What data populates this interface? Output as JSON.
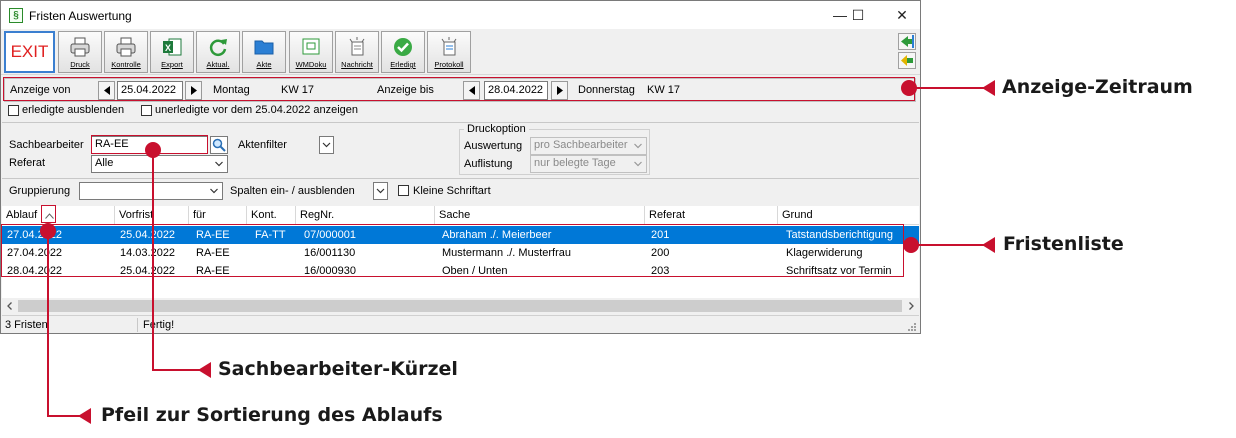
{
  "window": {
    "title": "Fristen Auswertung",
    "controls": {
      "minimize": "—",
      "maximize": "☐",
      "close": "✕"
    }
  },
  "toolbar": {
    "exit": "EXIT",
    "buttons": [
      {
        "label": "Druck",
        "icon": "printer-icon"
      },
      {
        "label": "Kontrolle",
        "icon": "printer-icon"
      },
      {
        "label": "Export",
        "icon": "excel-icon"
      },
      {
        "label": "Aktual.",
        "icon": "refresh-icon"
      },
      {
        "label": "Akte",
        "icon": "folder-icon"
      },
      {
        "label": "WMDoku",
        "icon": "document-icon"
      },
      {
        "label": "Nachricht",
        "icon": "message-icon"
      },
      {
        "label": "Erledigt",
        "icon": "check-icon"
      },
      {
        "label": "Protokoll",
        "icon": "protocol-icon"
      }
    ]
  },
  "zeitraum": {
    "von_label": "Anzeige von",
    "von_date": "25.04.2022",
    "von_weekday": "Montag",
    "von_kw": "KW 17",
    "bis_label": "Anzeige bis",
    "bis_date": "28.04.2022",
    "bis_weekday": "Donnerstag",
    "bis_kw": "KW 17"
  },
  "options": {
    "hide_done": "erledigte ausblenden",
    "show_open_before": "unerledigte vor dem 25.04.2022 anzeigen"
  },
  "filter": {
    "sachbearbeiter_label": "Sachbearbeiter",
    "sachbearbeiter_value": "RA-EE",
    "aktenfilter_label": "Aktenfilter",
    "referat_label": "Referat",
    "referat_value": "Alle"
  },
  "druckoption": {
    "title": "Druckoption",
    "auswertung_label": "Auswertung",
    "auswertung_value": "pro Sachbearbeiter",
    "auflistung_label": "Auflistung",
    "auflistung_value": "nur belegte Tage"
  },
  "gruppierung": {
    "label": "Gruppierung",
    "value": "",
    "spalten_label": "Spalten ein- / ausblenden",
    "kleine_schrift": "Kleine Schriftart"
  },
  "table": {
    "columns": [
      "Ablauf",
      "Vorfrist",
      "für",
      "Kont.",
      "RegNr.",
      "Sache",
      "Referat",
      "Grund"
    ],
    "rows": [
      [
        "27.04.2022",
        "25.04.2022",
        "RA-EE",
        "FA-TT",
        "07/000001",
        "Abraham ./. Meierbeer",
        "201",
        "Tatstandsberichtigung"
      ],
      [
        "27.04.2022",
        "14.03.2022",
        "RA-EE",
        "",
        "16/001130",
        "Mustermann ./. Musterfrau",
        "200",
        "Klagerwiderung"
      ],
      [
        "28.04.2022",
        "25.04.2022",
        "RA-EE",
        "",
        "16/000930",
        "Oben / Unten",
        "203",
        "Schriftsatz vor Termin"
      ]
    ]
  },
  "status": {
    "count": "3 Fristen",
    "state": "Fertig!"
  },
  "annotations": {
    "zeitraum": "Anzeige-Zeitraum",
    "fristenliste": "Fristenliste",
    "kuerzel": "Sachbearbeiter-Kürzel",
    "sortierung": "Pfeil zur Sortierung des Ablaufs"
  },
  "colors": {
    "accent": "#c8102e",
    "selection": "#0078d7"
  }
}
